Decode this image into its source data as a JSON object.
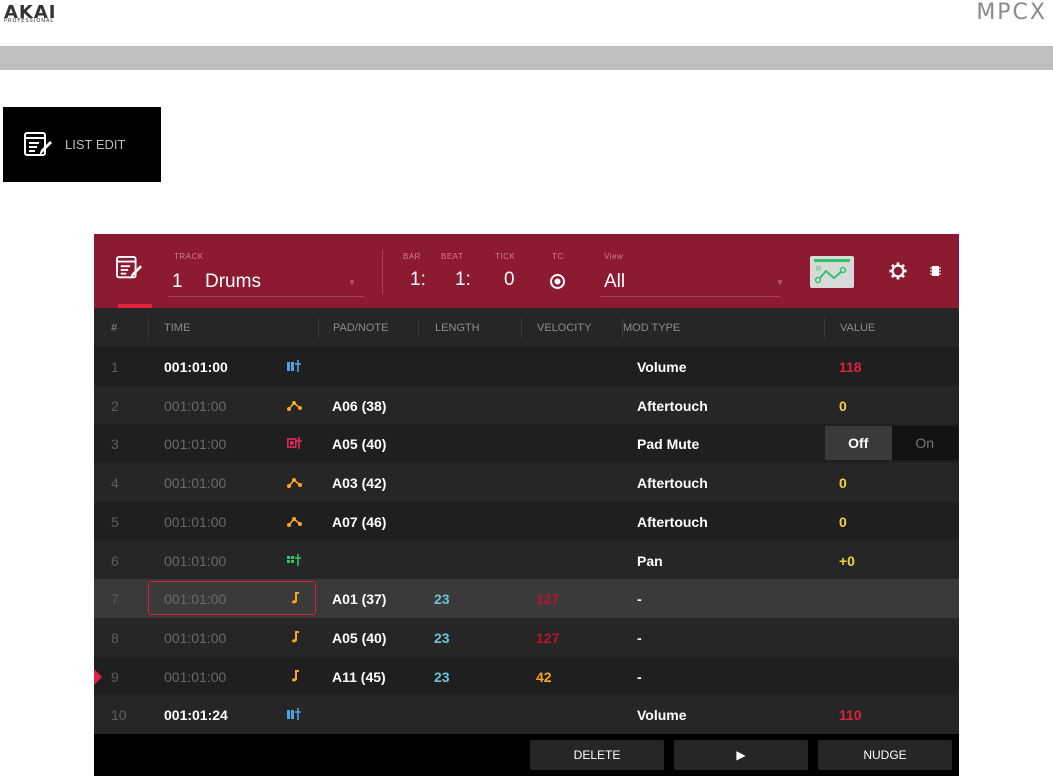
{
  "header": {
    "brand_left": "AKAI",
    "brand_left_sub": "PROFESSIONAL",
    "brand_right": "MPCX"
  },
  "mode_card": {
    "label": "LIST EDIT",
    "icon": "list-edit-icon"
  },
  "topbar": {
    "track_label": "TRACK",
    "track_number": "1",
    "track_name": "Drums",
    "bar_label": "BAR",
    "bar_value": "1:",
    "beat_label": "BEAT",
    "beat_value": "1:",
    "tick_label": "TICK",
    "tick_value": "0",
    "tc_label": "TC",
    "view_label": "View",
    "view_value": "All"
  },
  "columns": [
    "#",
    "TIME",
    "PAD/NOTE",
    "LENGTH",
    "VELOCITY",
    "MOD TYPE",
    "VALUE"
  ],
  "rows": [
    {
      "num": "1",
      "time": "001:01:00",
      "icon": "automation-bar-icon",
      "pad": "",
      "len": "",
      "vel": "",
      "mod": "Volume",
      "val": "118"
    },
    {
      "num": "2",
      "time": "001:01:00",
      "icon": "aftertouch-icon",
      "pad": "A06 (38)",
      "len": "",
      "vel": "",
      "mod": "Aftertouch",
      "val": "0"
    },
    {
      "num": "3",
      "time": "001:01:00",
      "icon": "pad-mute-icon",
      "pad": "A05 (40)",
      "len": "",
      "vel": "",
      "mod": "Pad Mute",
      "val": ""
    },
    {
      "num": "4",
      "time": "001:01:00",
      "icon": "aftertouch-icon",
      "pad": "A03 (42)",
      "len": "",
      "vel": "",
      "mod": "Aftertouch",
      "val": "0"
    },
    {
      "num": "5",
      "time": "001:01:00",
      "icon": "aftertouch-icon",
      "pad": "A07 (46)",
      "len": "",
      "vel": "",
      "mod": "Aftertouch",
      "val": "0"
    },
    {
      "num": "6",
      "time": "001:01:00",
      "icon": "pan-icon",
      "pad": "",
      "len": "",
      "vel": "",
      "mod": "Pan",
      "val": "+0"
    },
    {
      "num": "7",
      "time": "001:01:00",
      "icon": "note-icon",
      "pad": "A01 (37)",
      "len": "23",
      "vel": "127",
      "mod": "-",
      "val": ""
    },
    {
      "num": "8",
      "time": "001:01:00",
      "icon": "note-icon",
      "pad": "A05 (40)",
      "len": "23",
      "vel": "127",
      "mod": "-",
      "val": ""
    },
    {
      "num": "9",
      "time": "001:01:00",
      "icon": "note-icon",
      "pad": "A11 (45)",
      "len": "23",
      "vel": "42",
      "mod": "-",
      "val": ""
    },
    {
      "num": "10",
      "time": "001:01:24",
      "icon": "automation-bar-icon",
      "pad": "",
      "len": "",
      "vel": "",
      "mod": "Volume",
      "val": "110"
    }
  ],
  "toggle": {
    "off_label": "Off",
    "on_label": "On"
  },
  "buttons": {
    "delete": "DELETE",
    "play": "▶",
    "nudge": "NUDGE"
  },
  "colors": {
    "topbar": "#8c1a30",
    "accent_red": "#e0223f",
    "value_yellow": "#f2d43c",
    "length_cyan": "#6ec3d8",
    "note_orange": "#f5a623",
    "automation_blue": "#4fa3e0",
    "pan_green": "#2fc36a",
    "mute_pink": "#e02a5b"
  }
}
